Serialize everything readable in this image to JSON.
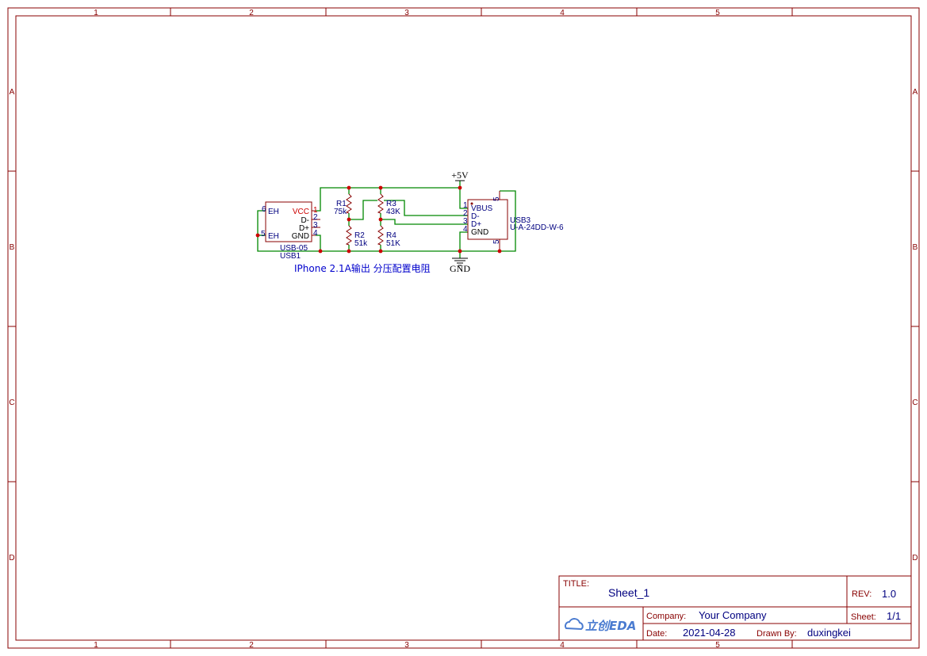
{
  "frame": {
    "columns": [
      "1",
      "2",
      "3",
      "4",
      "5"
    ],
    "rows": [
      "A",
      "B",
      "C",
      "D"
    ]
  },
  "components": {
    "usb1": {
      "designator": "USB1",
      "part": "USB-05",
      "pins_left": [
        {
          "num": "6",
          "name": "EH"
        },
        {
          "num": "5",
          "name": "EH"
        }
      ],
      "pins_right": [
        {
          "num": "1",
          "name": "VCC"
        },
        {
          "num": "2",
          "name": "D-"
        },
        {
          "num": "3",
          "name": "D+"
        },
        {
          "num": "4",
          "name": "GND"
        }
      ]
    },
    "usb3": {
      "designator": "USB3",
      "part": "U-A-24DD-W-6",
      "pins_left": [
        {
          "num": "1",
          "name": "VBUS"
        },
        {
          "num": "2",
          "name": "D-"
        },
        {
          "num": "3",
          "name": "D+"
        },
        {
          "num": "4",
          "name": "GND"
        }
      ],
      "pins_right": [
        {
          "num": "5"
        },
        {
          "num": "5"
        }
      ]
    },
    "r1": {
      "designator": "R1",
      "value": "75k"
    },
    "r2": {
      "designator": "R2",
      "value": "51k"
    },
    "r3": {
      "designator": "R3",
      "value": "43K"
    },
    "r4": {
      "designator": "R4",
      "value": "51K"
    }
  },
  "nets": {
    "vcc": "+5V",
    "gnd": "GND"
  },
  "annotation": "IPhone 2.1A输出 分压配置电阻",
  "title_block": {
    "title_label": "TITLE:",
    "title": "Sheet_1",
    "rev_label": "REV:",
    "rev": "1.0",
    "logo": "立创EDA",
    "company_label": "Company:",
    "company": "Your Company",
    "sheet_label": "Sheet:",
    "sheet": "1/1",
    "date_label": "Date:",
    "date": "2021-04-28",
    "drawn_label": "Drawn By:",
    "drawn": "duxingkei"
  },
  "colors": {
    "frame": "#880000",
    "wire": "#008800",
    "junction": "#cc0000",
    "pin_text": "#000080",
    "title_text": "#000080"
  }
}
